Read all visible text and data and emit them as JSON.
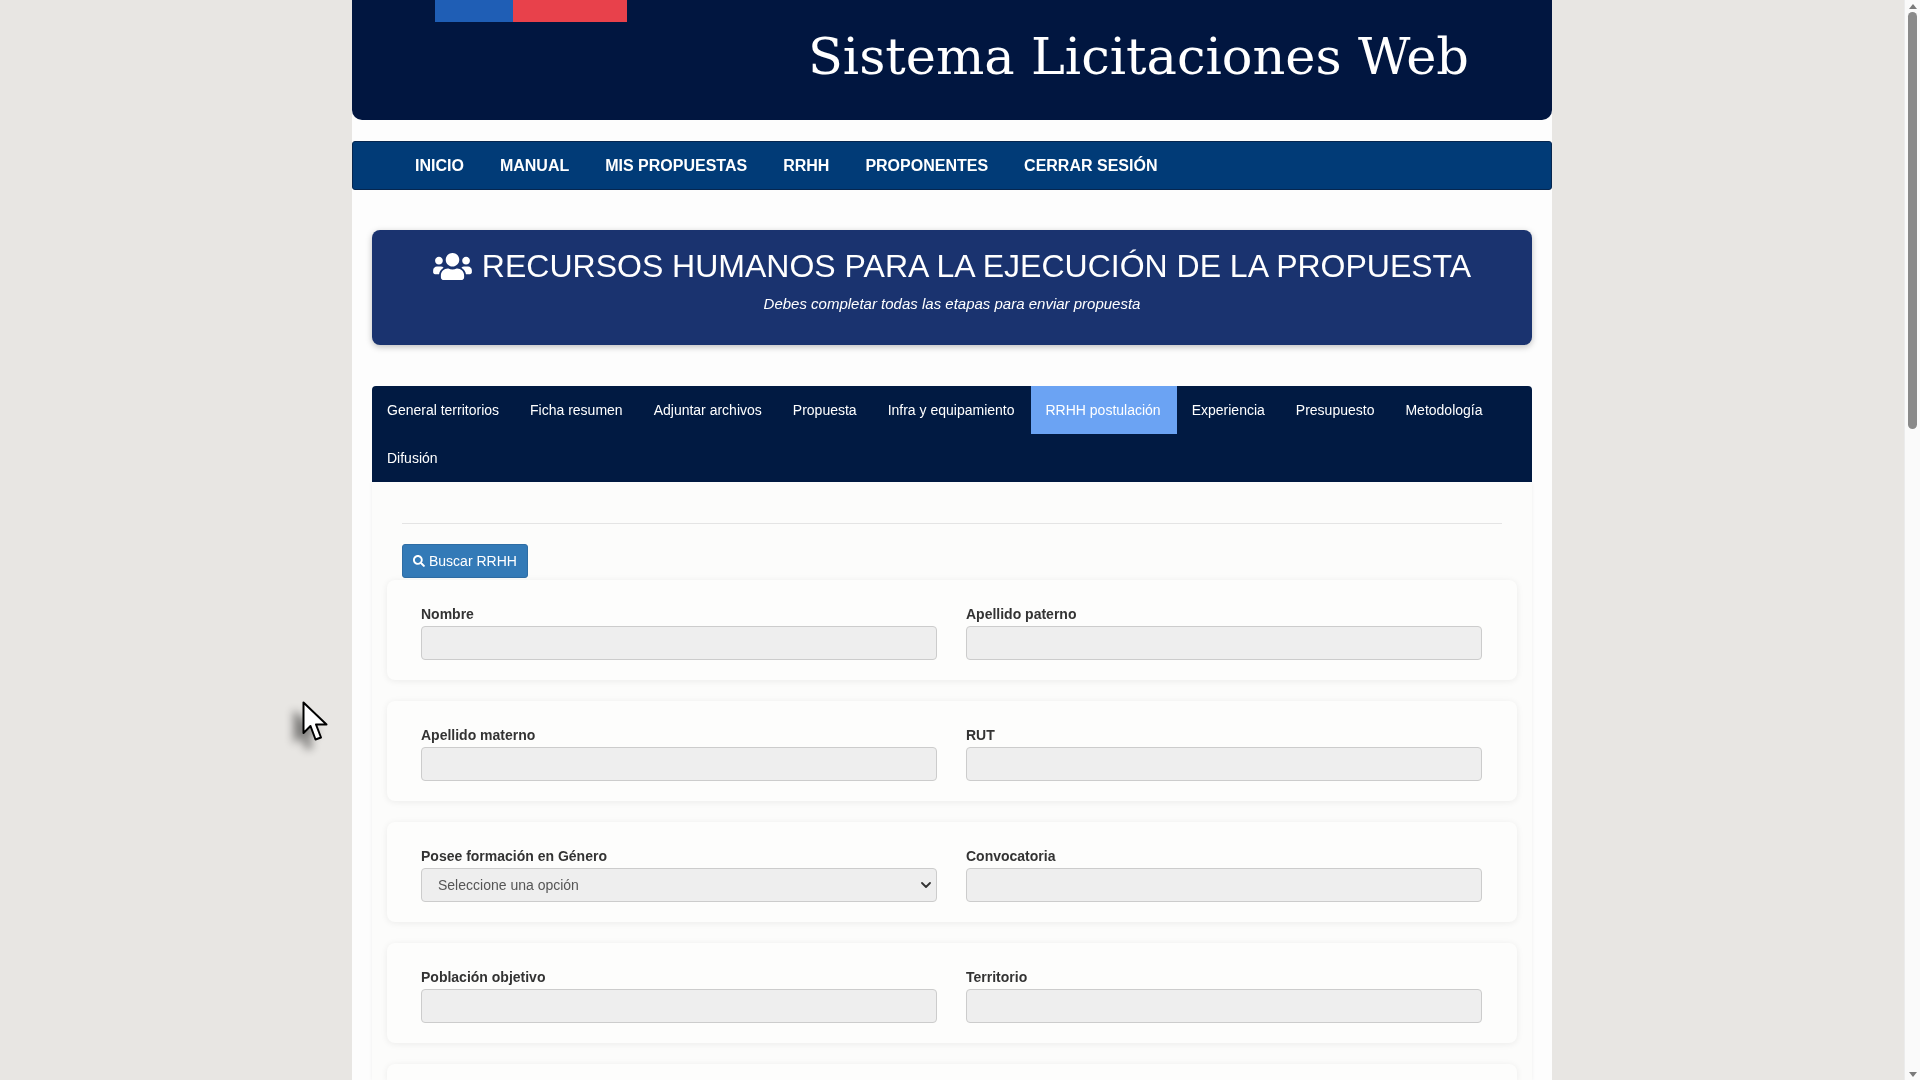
{
  "header": {
    "title": "Sistema Licitaciones Web"
  },
  "nav": [
    {
      "label": "INICIO"
    },
    {
      "label": "MANUAL"
    },
    {
      "label": "MIS PROPUESTAS"
    },
    {
      "label": "RRHH"
    },
    {
      "label": "PROPONENTES"
    },
    {
      "label": "CERRAR SESIÓN"
    }
  ],
  "banner": {
    "title": "RECURSOS HUMANOS PARA LA EJECUCIÓN DE LA PROPUESTA",
    "subtitle": "Debes completar todas las etapas para enviar propuesta"
  },
  "tabs": [
    {
      "label": "General territorios",
      "selected": false
    },
    {
      "label": "Ficha resumen",
      "selected": false
    },
    {
      "label": "Adjuntar archivos",
      "selected": false
    },
    {
      "label": "Propuesta",
      "selected": false
    },
    {
      "label": "Infra y equipamiento",
      "selected": false
    },
    {
      "label": "RRHH postulación",
      "selected": true
    },
    {
      "label": "Experiencia",
      "selected": false
    },
    {
      "label": "Presupuesto",
      "selected": false
    },
    {
      "label": "Metodología",
      "selected": false
    },
    {
      "label": "Difusión",
      "selected": false
    }
  ],
  "search_button": {
    "label": "Buscar RRHH"
  },
  "form_rows": [
    {
      "fields": [
        {
          "kind": "text",
          "label": "Nombre",
          "disabled": true
        },
        {
          "kind": "text",
          "label": "Apellido paterno",
          "disabled": true
        }
      ]
    },
    {
      "fields": [
        {
          "kind": "text",
          "label": "Apellido materno",
          "disabled": true
        },
        {
          "kind": "text",
          "label": "RUT",
          "disabled": true
        }
      ]
    },
    {
      "fields": [
        {
          "kind": "select",
          "label": "Posee formación en Género",
          "placeholder": "Seleccione una opción",
          "disabled": true
        },
        {
          "kind": "text",
          "label": "Convocatoria",
          "disabled": true
        }
      ]
    },
    {
      "fields": [
        {
          "kind": "text",
          "label": "Población objetivo",
          "disabled": true
        },
        {
          "kind": "text",
          "label": "Territorio",
          "disabled": true
        }
      ]
    }
  ]
}
